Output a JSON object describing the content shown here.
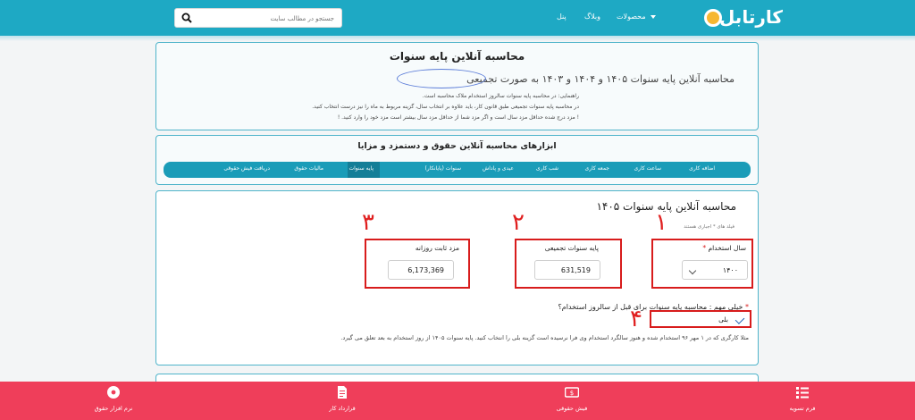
{
  "header": {
    "logo_text": "کارتابل",
    "nav": {
      "products": "محصولات",
      "blog": "وبلاگ",
      "panel": "پنل"
    },
    "search_placeholder": "جستجو در مطالب سایت"
  },
  "intro": {
    "title": "محاسبه آنلاین پایه سنوات",
    "subtitle": "محاسبه آنلاین پایه سنوات ۱۴۰۵ و ۱۴۰۴ و ۱۴۰۳ به صورت تجمیعی",
    "lines": [
      "راهنمایی: در محاسبه پایه سنوات سالروز استخدام ملاک محاسبه است.",
      "در محاسبه پایه سنوات تجمیعی طبق قانون کار، باید علاوه بر انتخاب سال، گزینه مربوط به ماه را نیز درست انتخاب کنید.",
      "! مزد درج شده حداقل مزد سال است و اگر مزد شما از حداقل مزد سال بیشتر است مزد خود را وارد کنید. !"
    ]
  },
  "tools": {
    "title": "ابزارهای محاسبه آنلاین حقوق و دستمزد و مزایا",
    "tabs": [
      "اضافه کاری",
      "ساعت کاری",
      "جمعه کاری",
      "شب کاری",
      "عیدی و پاداش",
      "سنوات (پایانکار)",
      "پایه سنوات",
      "مالیات حقوق",
      "دریافت فیش حقوقی"
    ],
    "active_tab": "پایه سنوات"
  },
  "calculator": {
    "title": "محاسبه آنلاین پایه سنوات ۱۴۰۵",
    "hint": "فیلد های * اجباری هستند",
    "year_label": "سال استخدام",
    "year_value": "۱۴۰۰",
    "base_label": "پایه سنوات تجمیعی",
    "base_value": "631,519",
    "wage_label": "مزد ثابت روزانه",
    "wage_value": "6,173,369",
    "question": "خیلی مهم : محاسبه پایه سنوات برای قبل از سالروز استخدام؟",
    "checkbox_label": "بلی",
    "example": "مثلا کارگری که در ۱ مهر ۹۶ استخدام شده و هنوز سالگرد استخدام وی فرا نرسیده است گزینه بلی را انتخاب کنید. پایه سنوات ۱۴۰۵ از روز استخدام به بعد تعلق می گیرد.",
    "annotations": [
      "۱",
      "۲",
      "۳",
      "۴"
    ]
  },
  "bottom_bar": {
    "items": [
      "فرم تسویه",
      "فیش حقوقی",
      "قرارداد کار",
      "نرم افزار حقوق"
    ]
  },
  "colors": {
    "primary": "#1ea9c4",
    "tab_bar": "#1a9cb8",
    "bottom_bar": "#ef3e5a",
    "annotation_red": "#d81c1c"
  }
}
